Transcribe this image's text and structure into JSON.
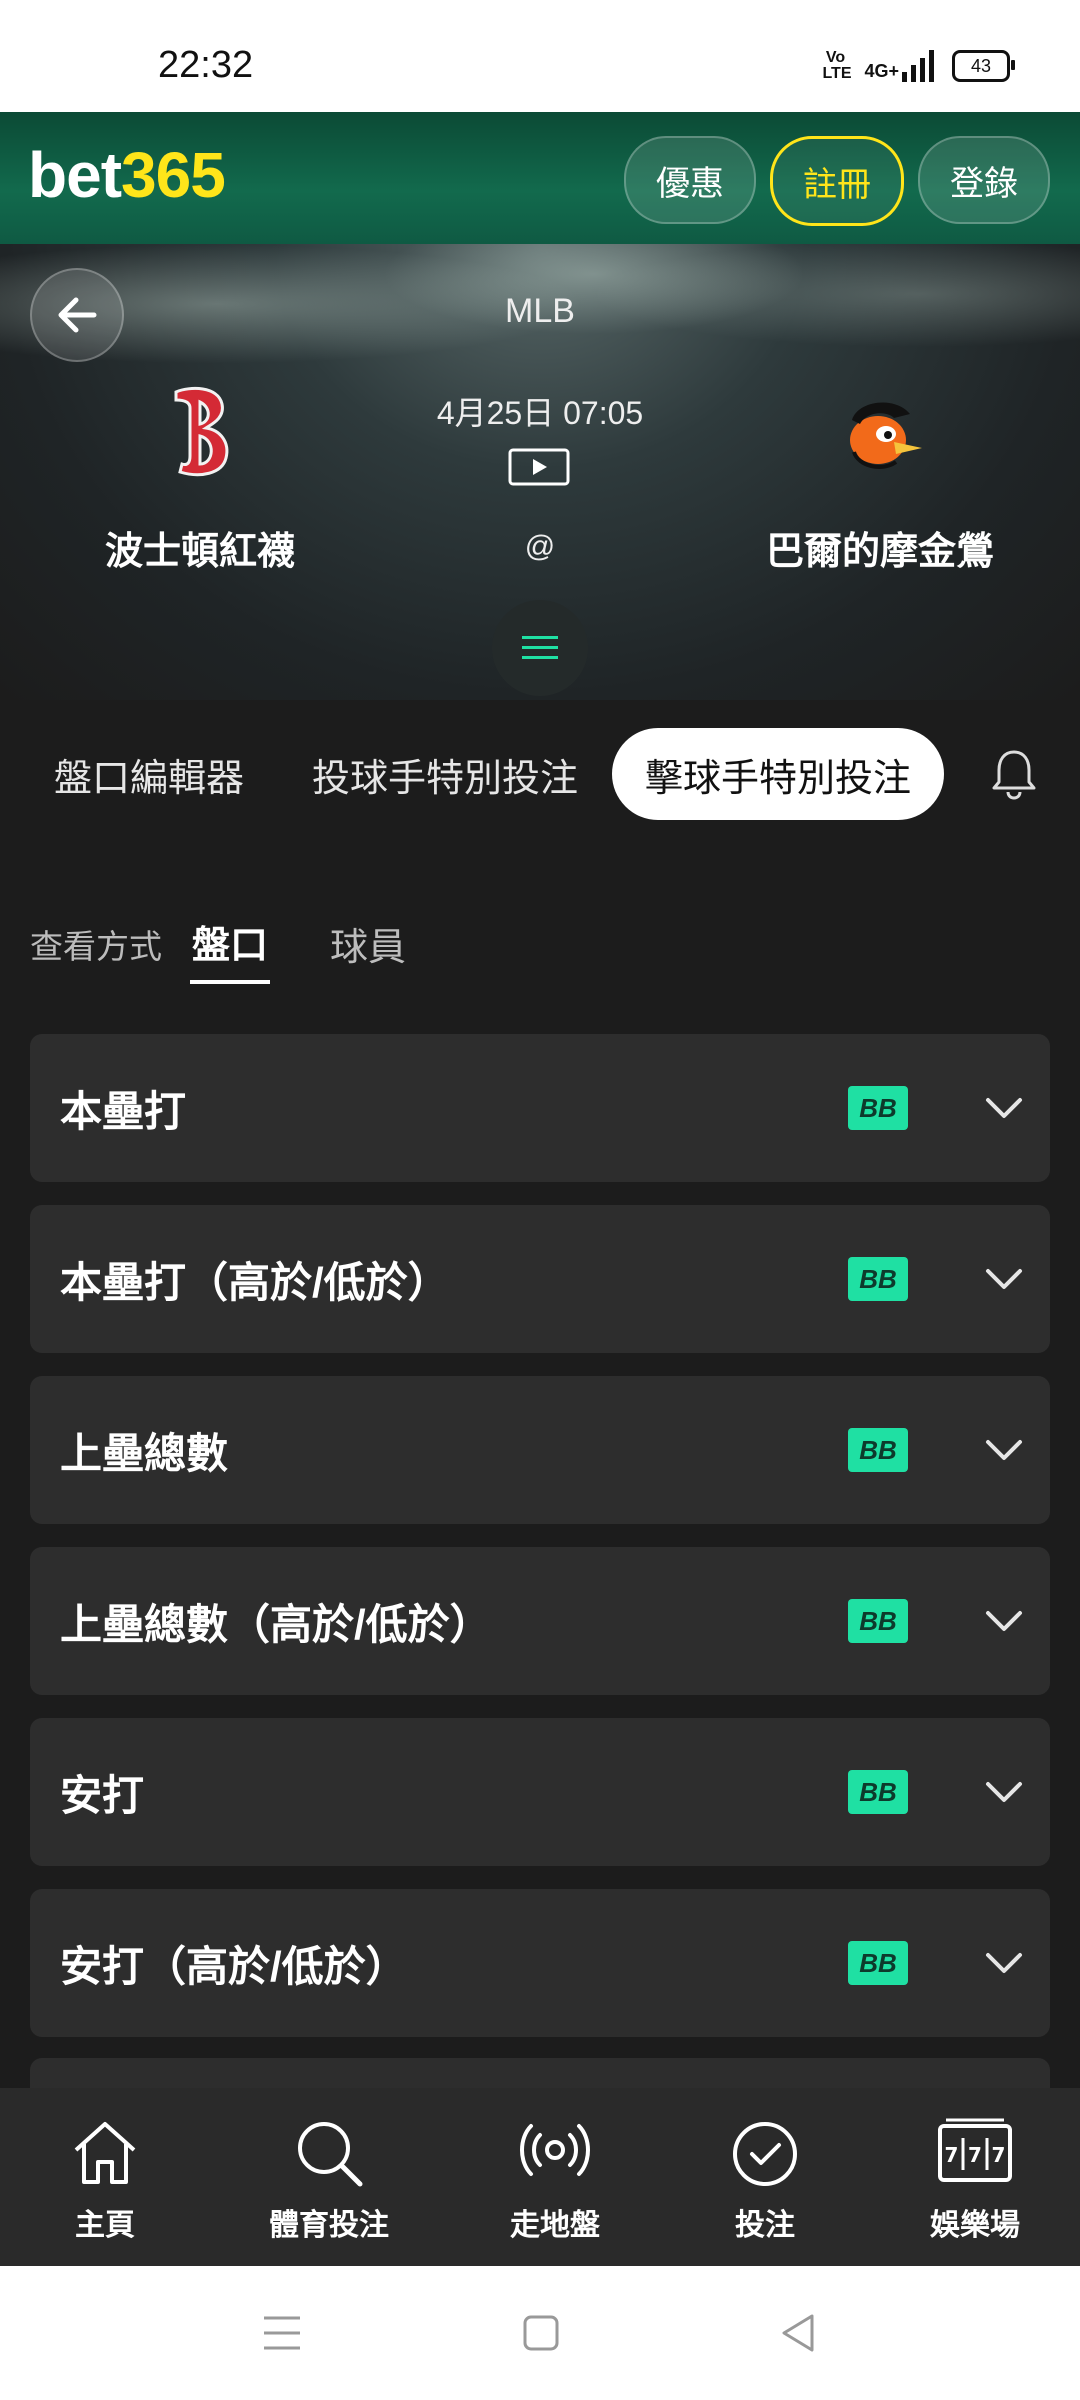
{
  "status_bar": {
    "time": "22:32",
    "volte": "Vo LTE",
    "network": "4G+",
    "battery": "43"
  },
  "header": {
    "logo_part1": "bet",
    "logo_part2": "365",
    "btn_offers": "優惠",
    "btn_register": "註冊",
    "btn_login": "登錄"
  },
  "match": {
    "league": "MLB",
    "datetime": "4月25日 07:05",
    "at": "@",
    "home_team": "波士頓紅襪",
    "away_team": "巴爾的摩金鶯"
  },
  "tabs": {
    "editor": "盤口編輯器",
    "pitcher": "投球手特別投注",
    "batter": "擊球手特別投注"
  },
  "view": {
    "label": "查看方式",
    "market": "盤口",
    "players": "球員"
  },
  "markets": [
    {
      "title": "本壘打",
      "badge": "BB"
    },
    {
      "title": "本壘打（高於/低於）",
      "badge": "BB"
    },
    {
      "title": "上壘總數",
      "badge": "BB"
    },
    {
      "title": "上壘總數（高於/低於）",
      "badge": "BB"
    },
    {
      "title": "安打",
      "badge": "BB"
    },
    {
      "title": "安打（高於/低於）",
      "badge": "BB"
    }
  ],
  "bottom_nav": [
    {
      "label": "主頁",
      "icon": "home-icon"
    },
    {
      "label": "體育投注",
      "icon": "search-icon"
    },
    {
      "label": "走地盤",
      "icon": "live-broadcast-icon"
    },
    {
      "label": "投注",
      "icon": "check-circle-icon"
    },
    {
      "label": "娛樂場",
      "icon": "slot-machine-icon"
    }
  ],
  "colors": {
    "accent_green": "#1fe0a3",
    "brand_yellow": "#ffe51a",
    "header_green": "#126a4d",
    "background": "#1c1c1c",
    "card": "#2d2d2d"
  }
}
